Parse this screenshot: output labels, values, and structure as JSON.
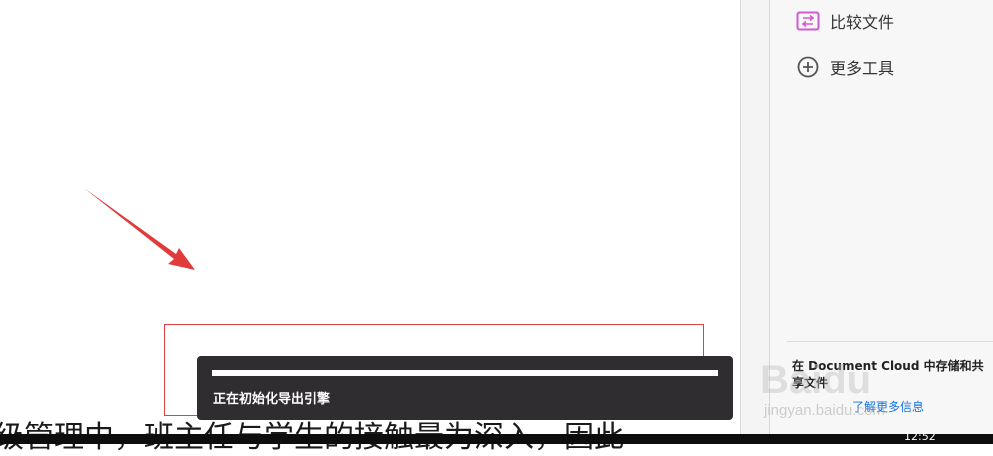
{
  "document": {
    "body_text": "级管理中，班主任与学生的接触最为深入，因此"
  },
  "tools_panel": {
    "items": [
      {
        "label": "比较文件",
        "icon": "compare-files-icon"
      },
      {
        "label": "更多工具",
        "icon": "add-circle-icon"
      }
    ],
    "cloud_promo": {
      "text": "在 Document Cloud 中存储和共享文件",
      "link": "了解更多信息"
    }
  },
  "export_toast": {
    "message": "正在初始化导出引擎",
    "progress": 1.0
  },
  "taskbar": {
    "clock": "12:52"
  },
  "watermark": {
    "brand": "Baidu",
    "sub": "jingyan.baidu.com"
  },
  "colors": {
    "annotation_red": "#e03a3a",
    "toast_bg": "#2f2d2f",
    "link_blue": "#1473e6",
    "compare_icon": "#d05ad0"
  }
}
